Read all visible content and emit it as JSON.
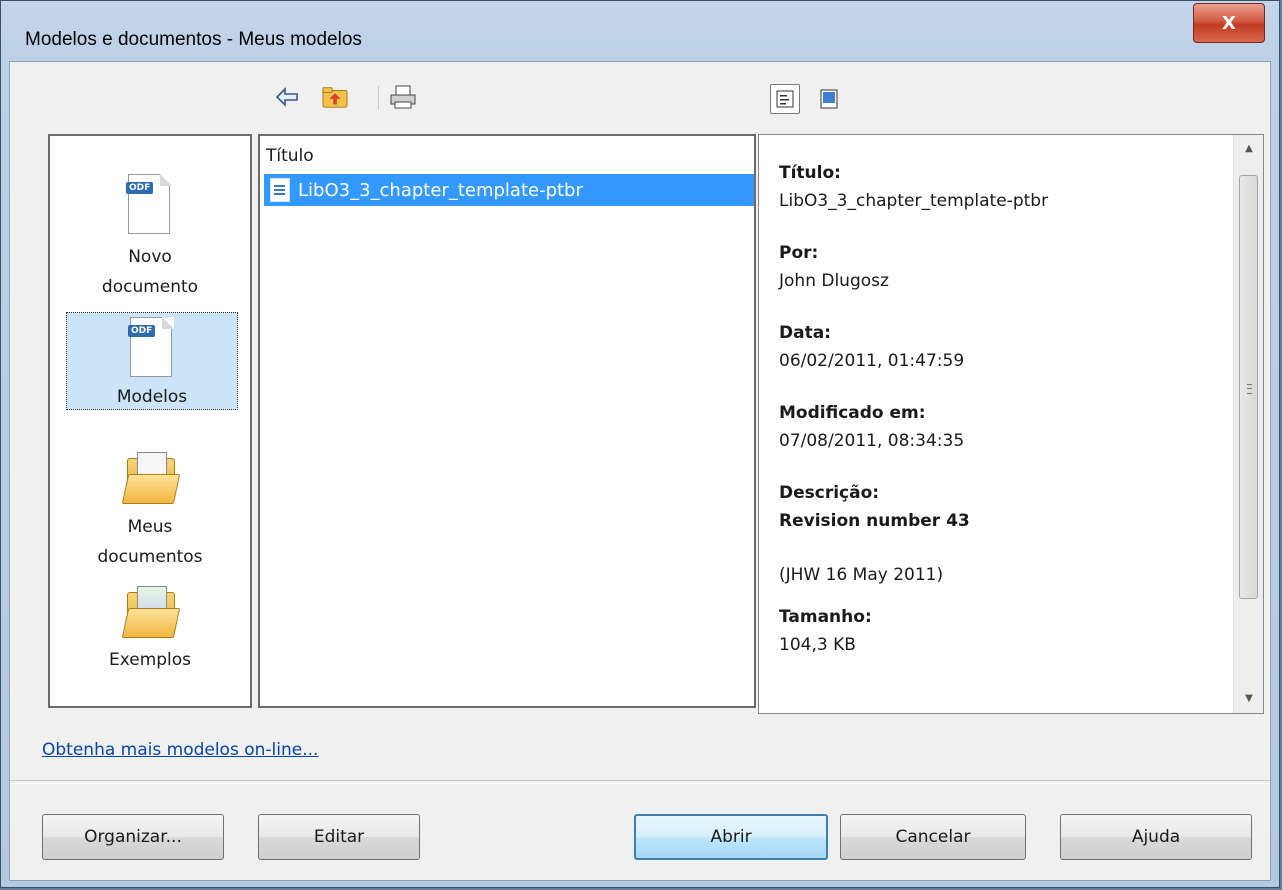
{
  "window": {
    "title": "Modelos e documentos - Meus modelos",
    "close_glyph": "X"
  },
  "toolbar": {
    "icons": [
      "back-arrow-icon",
      "folder-up-icon",
      "print-icon"
    ],
    "view_icons": [
      "document-view-icon",
      "preview-view-icon"
    ]
  },
  "nav": {
    "items": [
      {
        "label": "Novo documento",
        "icon": "odf-document-icon",
        "selected": false
      },
      {
        "label": "Modelos",
        "icon": "odf-template-icon",
        "selected": true
      },
      {
        "label": "Meus documentos",
        "icon": "folder-icon",
        "selected": false
      },
      {
        "label": "Exemplos",
        "icon": "folder-icon",
        "selected": false
      }
    ]
  },
  "list": {
    "column_header": "Título",
    "rows": [
      {
        "name": "LibO3_3_chapter_template-ptbr",
        "selected": true
      }
    ]
  },
  "info": {
    "title_label": "Título:",
    "title_value": "LibO3_3_chapter_template-ptbr",
    "author_label": "Por:",
    "author_value": "John Dlugosz",
    "date_label": "Data:",
    "date_value": "06/02/2011, 01:47:59",
    "modified_label": "Modificado em:",
    "modified_value": "07/08/2011, 08:34:35",
    "description_label": "Descrição:",
    "description_line1": "Revision number 43",
    "description_line2": "(JHW 16 May 2011)",
    "size_label": "Tamanho:",
    "size_value": "104,3 KB"
  },
  "link_text": "Obtenha mais modelos on-line...",
  "buttons": {
    "organize": "Organizar...",
    "edit": "Editar",
    "open": "Abrir",
    "cancel": "Cancelar",
    "help": "Ajuda"
  },
  "colors": {
    "selection": "#3399ff",
    "link": "#0645ad",
    "close": "#c03a22"
  }
}
